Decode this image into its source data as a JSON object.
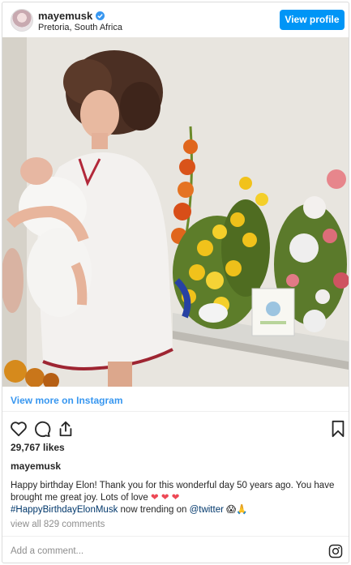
{
  "header": {
    "username": "mayemusk",
    "location": "Pretoria, South Africa",
    "view_profile_label": "View profile"
  },
  "post": {
    "view_more_label": "View more on Instagram",
    "likes": "29,767 likes",
    "caption_username": "mayemusk",
    "caption_text": "Happy birthday Elon! Thank you for this wonderful day 50 years ago. You have brought me great joy. Lots of love",
    "caption_hearts": "❤ ❤ ❤",
    "hashtag": "#HappyBirthdayElonMusk",
    "trending_text": "now trending on",
    "mention": "@twitter",
    "trailing_emoji": "😱🙏",
    "comments_link": "view all 829 comments"
  },
  "comment_box": {
    "placeholder": "Add a comment..."
  },
  "icons": {
    "verified": "verified-badge-icon",
    "like": "heart-icon",
    "comment": "comment-icon",
    "share": "share-icon",
    "save": "bookmark-icon",
    "instagram": "instagram-icon"
  },
  "colors": {
    "accent_blue": "#0095f6",
    "link_blue": "#3897f0",
    "hashtag_blue": "#00376b",
    "heart_red": "#ed4956",
    "muted_gray": "#8e8e8e"
  }
}
